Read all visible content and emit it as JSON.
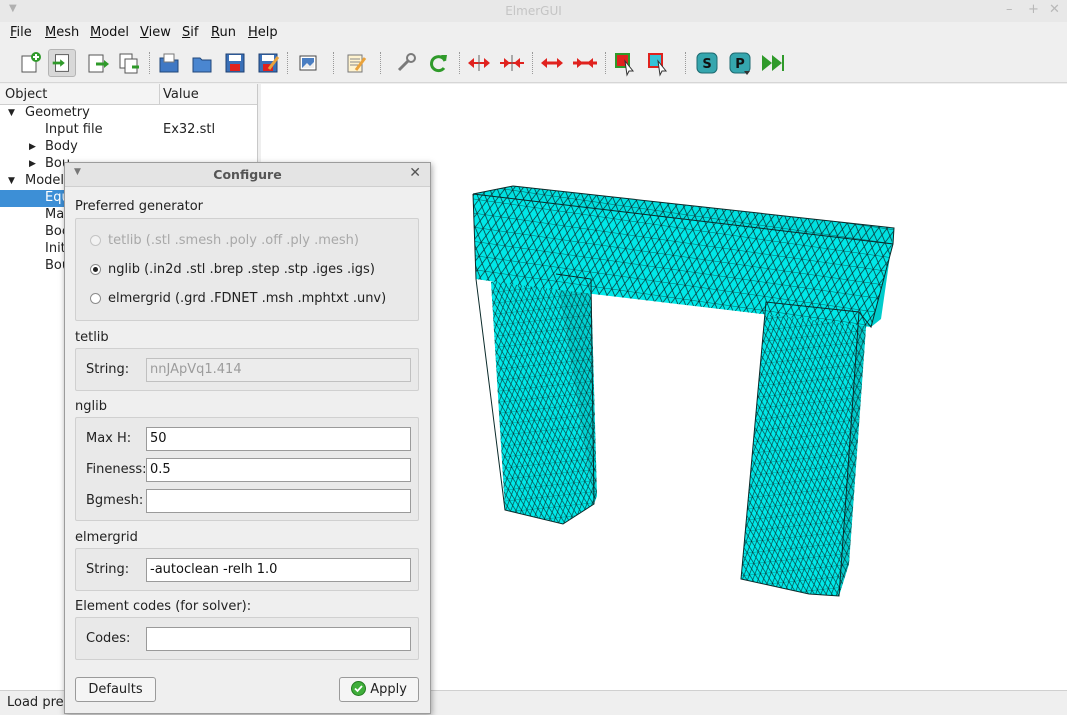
{
  "window": {
    "title": "ElmerGUI"
  },
  "menu": [
    {
      "label": "File",
      "u": "F",
      "rest": "ile"
    },
    {
      "label": "Mesh",
      "u": "M",
      "rest": "esh"
    },
    {
      "label": "Model",
      "u": "M",
      "rest": "odel"
    },
    {
      "label": "View",
      "u": "V",
      "rest": "iew"
    },
    {
      "label": "Sif",
      "u": "S",
      "rest": "if"
    },
    {
      "label": "Run",
      "u": "R",
      "rest": "un"
    },
    {
      "label": "Help",
      "u": "H",
      "rest": "elp"
    }
  ],
  "toolbar": {
    "icons": [
      "new-icon",
      "open-mesh-icon",
      "save-mesh-icon",
      "copy-icon",
      "open-project-icon",
      "folder-icon",
      "save-icon",
      "save-as-icon",
      "image-icon",
      "edit-icon",
      "wrench-icon",
      "reload-icon",
      "divide-icon",
      "unify-icon",
      "divide-edge-icon",
      "unify-edge-icon",
      "select-surface-icon",
      "select-edge-icon",
      "sif-icon",
      "parallel-icon",
      "run-icon"
    ],
    "colors": {
      "red": "#e0221e",
      "green": "#2f9a2a",
      "teal": "#35a6ae",
      "blue": "#4a7ec2"
    }
  },
  "tree": {
    "col_object": "Object",
    "col_value": "Value",
    "rows": [
      {
        "label": "Geometry",
        "value": "",
        "expanded": true
      },
      {
        "label": "Input file",
        "value": "Ex32.stl"
      },
      {
        "label": "Body",
        "value": "",
        "collapsed": true
      },
      {
        "label": "Bou",
        "value": "",
        "collapsed": true
      },
      {
        "label": "Model",
        "value": "",
        "expanded": true
      },
      {
        "label": "Equ",
        "value": "",
        "selected": true
      },
      {
        "label": "Ma",
        "value": ""
      },
      {
        "label": "Boc",
        "value": ""
      },
      {
        "label": "Init",
        "value": ""
      },
      {
        "label": "Bou",
        "value": ""
      }
    ]
  },
  "status": {
    "text": "Load prev"
  },
  "mesh": {
    "fill_color": "#00e8e8",
    "edge_color": "#0a2a2a"
  },
  "dialog": {
    "title": "Configure",
    "preferred_label": "Preferred generator",
    "options": [
      {
        "label": "tetlib (.stl .smesh .poly .off .ply .mesh)",
        "checked": false,
        "disabled": true
      },
      {
        "label": "nglib (.in2d .stl .brep .step .stp .iges .igs)",
        "checked": true,
        "disabled": false
      },
      {
        "label": "elmergrid (.grd .FDNET .msh .mphtxt .unv)",
        "checked": false,
        "disabled": false
      }
    ],
    "tetlib": {
      "group": "tetlib",
      "string_label": "String:",
      "string_value": "nnJApVq1.414"
    },
    "nglib": {
      "group": "nglib",
      "maxh_label": "Max H:",
      "maxh_value": "50",
      "fineness_label": "Fineness:",
      "fineness_value": "0.5",
      "bgmesh_label": "Bgmesh:",
      "bgmesh_value": ""
    },
    "elmergrid": {
      "group": "elmergrid",
      "string_label": "String:",
      "string_value": "-autoclean -relh 1.0"
    },
    "codes": {
      "group": "Element codes (for solver):",
      "codes_label": "Codes:",
      "codes_value": ""
    },
    "defaults_label": "Defaults",
    "apply_label": "Apply"
  }
}
